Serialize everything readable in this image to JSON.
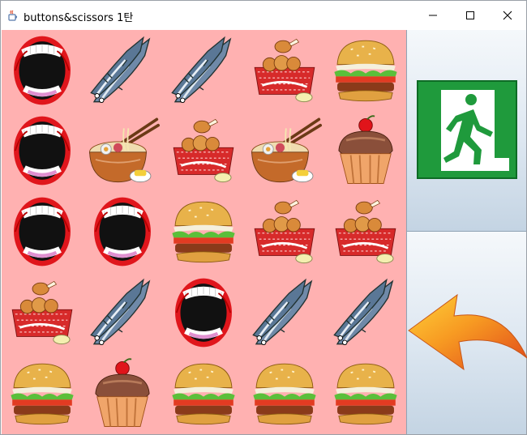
{
  "window": {
    "title": "buttons&scissors 1탄",
    "icon": "java-cup-icon",
    "controls": [
      "minimize-icon",
      "maximize-icon",
      "close-icon"
    ]
  },
  "board": {
    "background": "#ffb1b1",
    "rows": [
      [
        "mouth",
        "fish",
        "fish",
        "chicken",
        "burger"
      ],
      [
        "mouth",
        "ramen",
        "chicken",
        "ramen",
        "cupcake"
      ],
      [
        "mouth",
        "mouth",
        "burger",
        "chicken",
        "chicken"
      ],
      [
        "chicken",
        "fish",
        "mouth",
        "fish",
        "fish"
      ],
      [
        "burger",
        "cupcake",
        "burger",
        "burger",
        "burger"
      ]
    ]
  },
  "side_panel": {
    "exit_button_icon": "emergency-exit-icon",
    "back_button_icon": "curved-back-arrow-icon"
  }
}
